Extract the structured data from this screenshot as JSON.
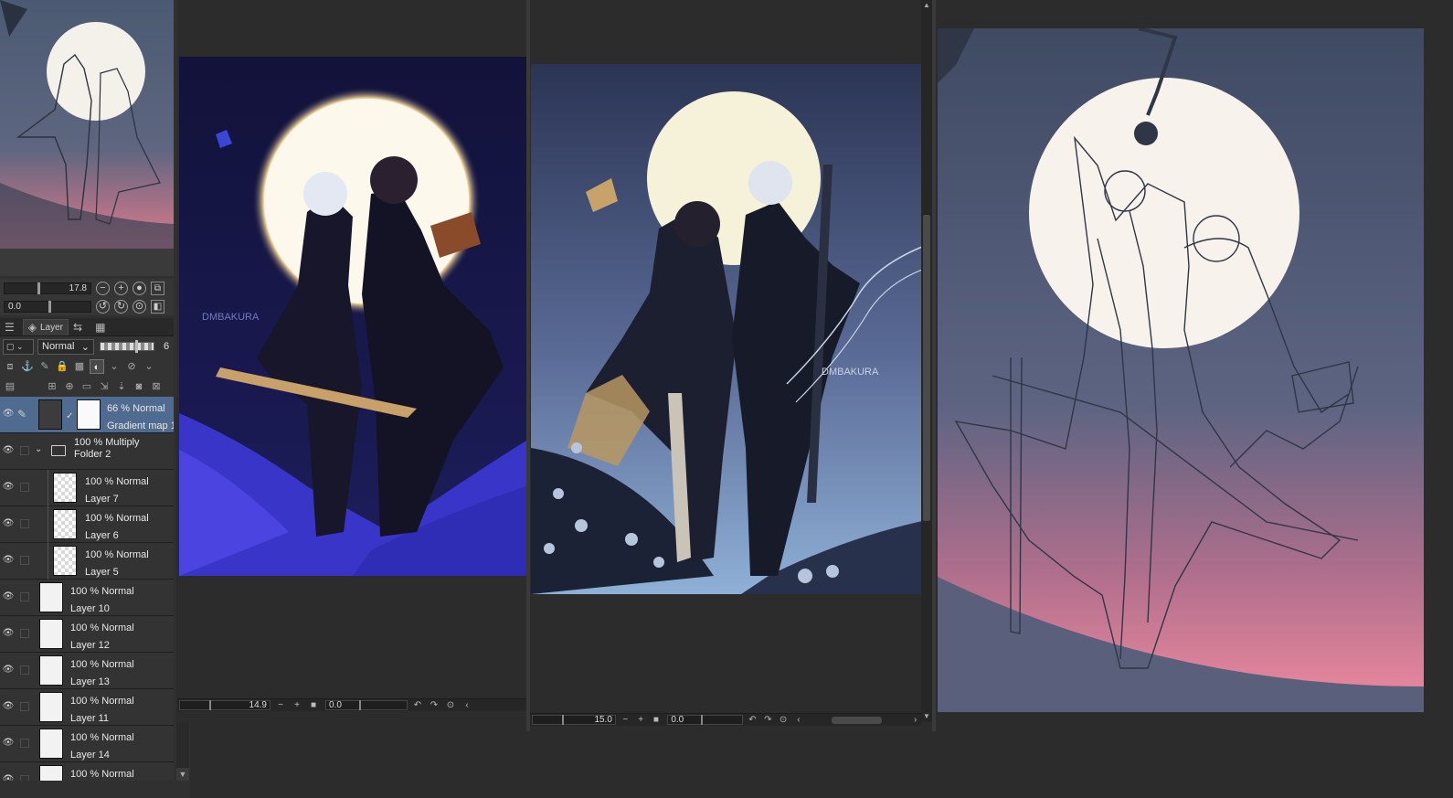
{
  "navigator": {
    "zoom_value": "17.8",
    "rotate_value": "0.0"
  },
  "layer_panel": {
    "tab_label": "Layer",
    "blend_mode": "Normal",
    "opacity": "6",
    "layers": [
      {
        "line1": "66 % Normal",
        "line2": "Gradient map 1"
      },
      {
        "line1": "100 % Multiply",
        "line2": "Folder 2"
      },
      {
        "line1": "100 % Normal",
        "line2": "Layer 7"
      },
      {
        "line1": "100 % Normal",
        "line2": "Layer 6"
      },
      {
        "line1": "100 % Normal",
        "line2": "Layer 5"
      },
      {
        "line1": "100 % Normal",
        "line2": "Layer 10"
      },
      {
        "line1": "100 % Normal",
        "line2": "Layer 12"
      },
      {
        "line1": "100 % Normal",
        "line2": "Layer 13"
      },
      {
        "line1": "100 % Normal",
        "line2": "Layer 11"
      },
      {
        "line1": "100 % Normal",
        "line2": "Layer 14"
      },
      {
        "line1": "100 % Normal",
        "line2": ""
      }
    ]
  },
  "canvas1": {
    "zoom": "14.9",
    "angle": "0.0",
    "signature": "DMBAKURA"
  },
  "canvas2": {
    "zoom": "15.0",
    "angle": "0.0",
    "signature": "DMBAKURA"
  },
  "colors": {
    "ui_bg": "#2c2c2c",
    "panel_bg": "#333333",
    "selected_layer": "#4f6b8f"
  }
}
